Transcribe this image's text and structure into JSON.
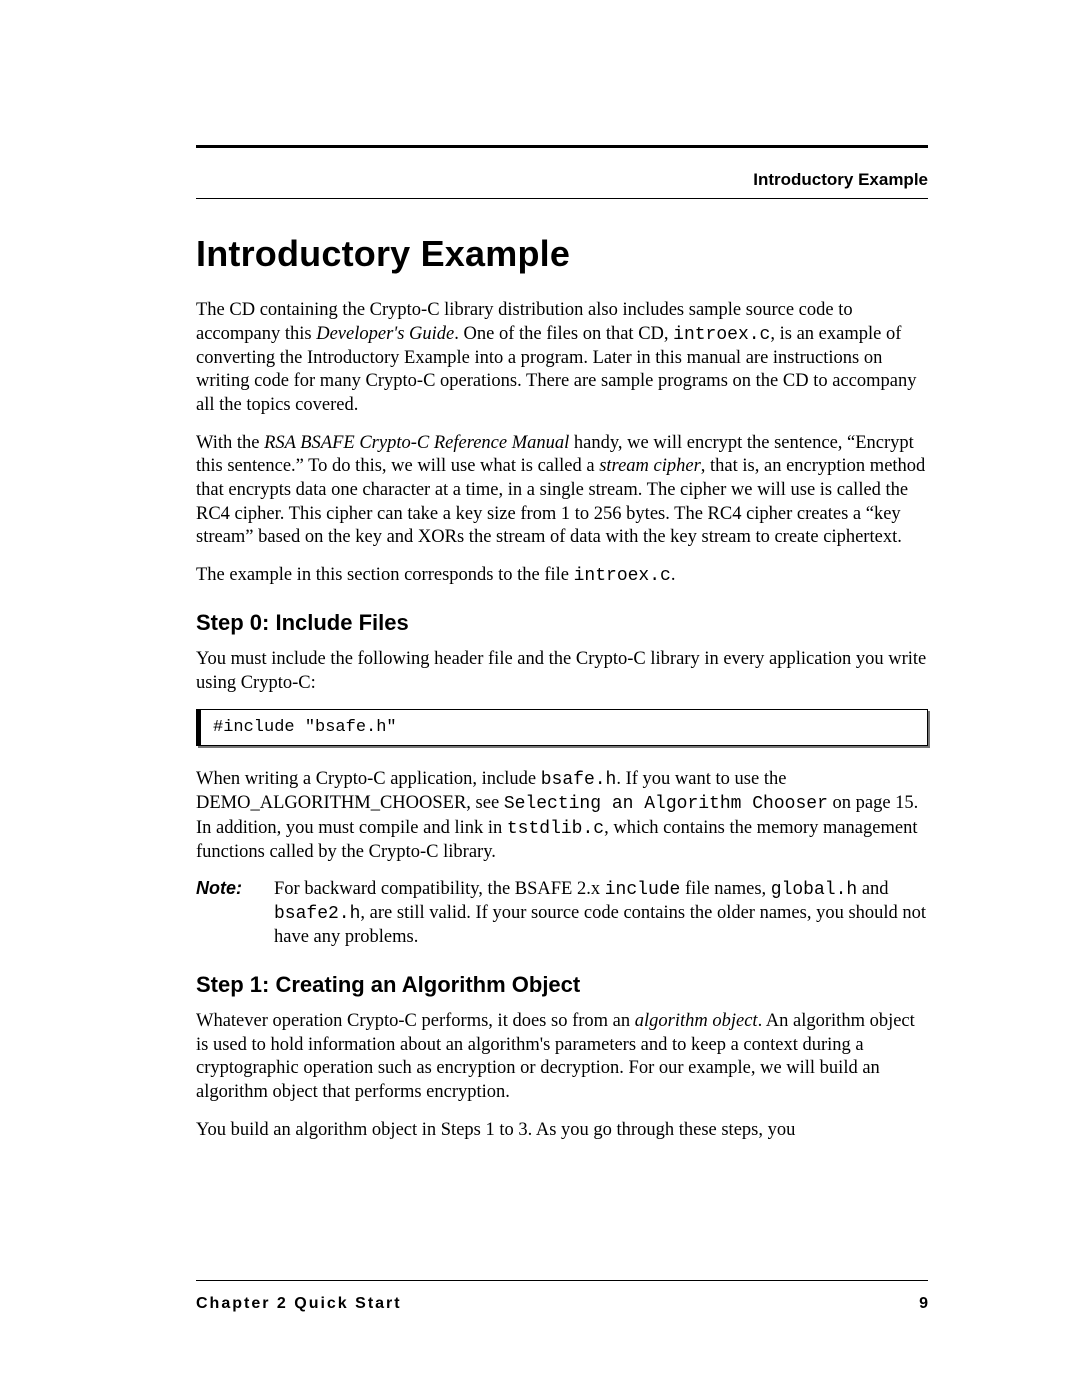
{
  "running_head": "Introductory Example",
  "title": "Introductory Example",
  "p1": {
    "a": "The CD containing the Crypto-C library distribution also includes sample source code to accompany this ",
    "b": "Developer's Guide",
    "c": ". One of the files on that CD, ",
    "d": "introex.c",
    "e": ", is an example of converting the Introductory Example into a program. Later in this manual are instructions on writing code for many Crypto-C operations. There are sample programs on the CD to accompany all the topics covered."
  },
  "p2": {
    "a": "With the ",
    "b": "RSA BSAFE Crypto-C Reference Manual",
    "c": " handy, we will encrypt the sentence, “Encrypt this sentence.” To do this, we will use what is called a ",
    "d": "stream cipher",
    "e": ", that is, an encryption method that encrypts data one character at a time, in a single stream. The cipher we will use is called the RC4 cipher. This cipher can take a key size from 1 to 256 bytes. The RC4 cipher creates a “key stream” based on the key and XORs the stream of data with the key stream to create ciphertext."
  },
  "p3": {
    "a": "The example in this section corresponds to the file ",
    "b": "introex.c",
    "c": "."
  },
  "step0": {
    "heading": "Step 0:  Include Files",
    "p": "You must include the following header file and the Crypto-C library in every application you write using Crypto-C:",
    "code": "#include \"bsafe.h\"",
    "p2": {
      "a": "When writing a Crypto-C application, include ",
      "b": "bsafe.h",
      "c": ". If you want to use the DEMO_ALGORITHM_CHOOSER, see ",
      "d": "Selecting an Algorithm Chooser",
      "e": " on page 15. In addition, you must compile and link in ",
      "f": "tstdlib.c",
      "g": ", which contains the memory management functions called by the Crypto-C library."
    },
    "note": {
      "label": "Note:",
      "a": "For backward compatibility, the BSAFE 2.x ",
      "b": "include",
      "c": " file names, ",
      "d": "global.h",
      "e": " and ",
      "f": "bsafe2.h",
      "g": ", are still valid. If your source code contains the older names, you should not have any problems."
    }
  },
  "step1": {
    "heading": "Step 1:  Creating an Algorithm Object",
    "p1": {
      "a": "Whatever operation Crypto-C performs, it does so from an ",
      "b": "algorithm object",
      "c": ". An algorithm object is used to hold information about an algorithm's parameters and to keep a context during a cryptographic operation such as encryption or decryption. For our example, we will build an algorithm object that performs encryption."
    },
    "p2": "You build an algorithm object in Steps 1 to 3. As you go through these steps, you"
  },
  "footer": {
    "chapter": "Chapter 2  Quick Start",
    "page": "9"
  }
}
